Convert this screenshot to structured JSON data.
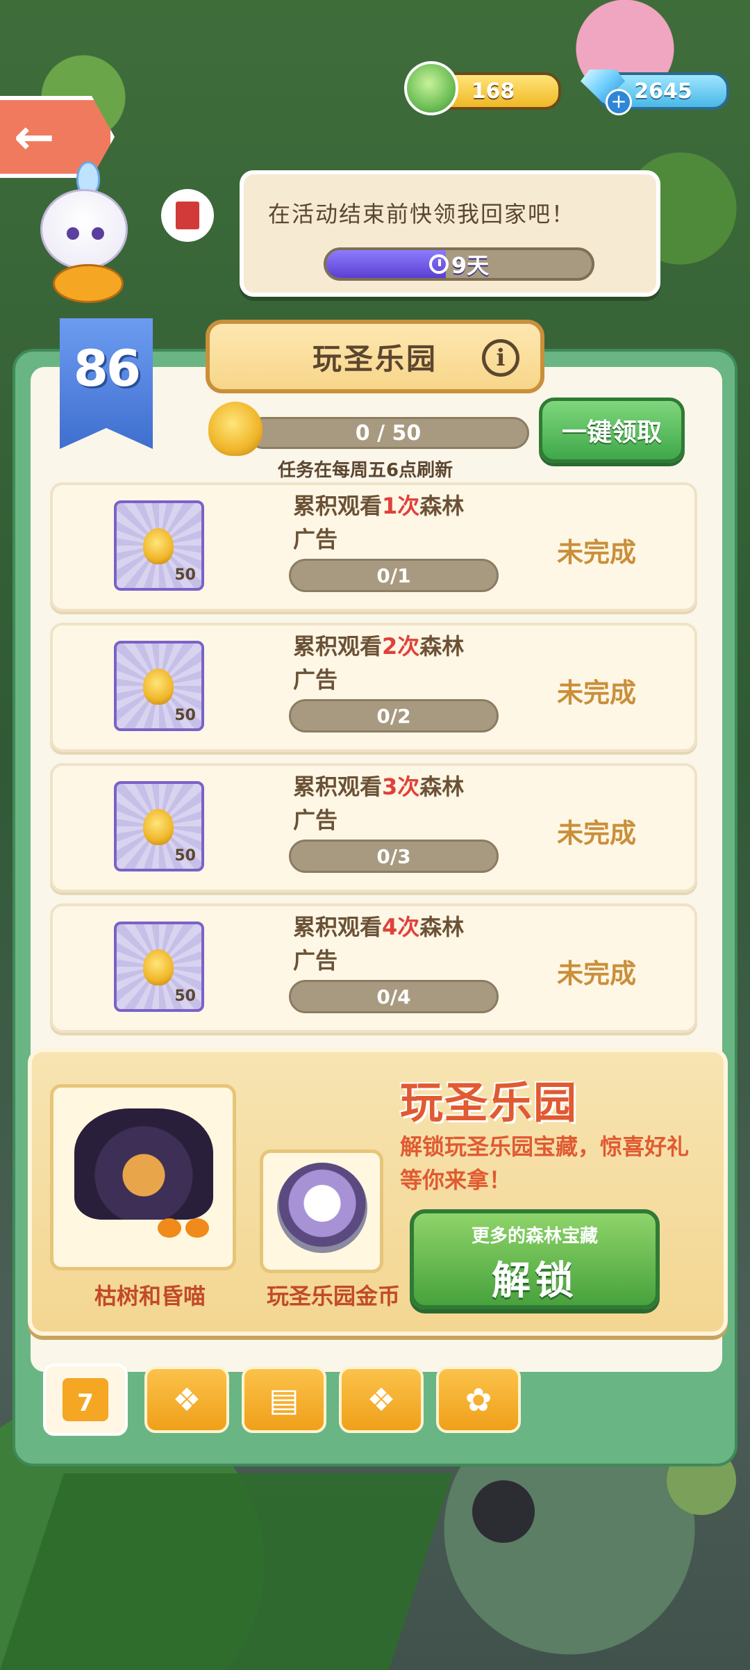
{
  "currency": {
    "leaf_count": "168",
    "gem_count": "2645"
  },
  "speech": {
    "message": "在活动结束前快领我回家吧！",
    "timer_label": "9天",
    "timer_fraction": 0.45
  },
  "level": "86",
  "panel": {
    "title": "玩圣乐园",
    "progress_text": "0 / 50",
    "claim_all_label": "一键领取",
    "refresh_note": "任务在每周五6点刷新"
  },
  "tasks": [
    {
      "pre": "累积观看",
      "count": "1次",
      "post": "森林广告",
      "reward": "50",
      "progress": "0/1",
      "status": "未完成"
    },
    {
      "pre": "累积观看",
      "count": "2次",
      "post": "森林广告",
      "reward": "50",
      "progress": "0/2",
      "status": "未完成"
    },
    {
      "pre": "累积观看",
      "count": "3次",
      "post": "森林广告",
      "reward": "50",
      "progress": "0/3",
      "status": "未完成"
    },
    {
      "pre": "累积观看",
      "count": "4次",
      "post": "森林广告",
      "reward": "50",
      "progress": "0/4",
      "status": "未完成"
    }
  ],
  "unlock": {
    "title": "玩圣乐园",
    "description": "解锁玩圣乐园宝藏，惊喜好礼等你来拿！",
    "item1_caption": "枯树和昏喵",
    "item2_caption": "玩圣乐园金币",
    "button_sub": "更多的森林宝藏",
    "button_main": "解锁"
  },
  "tabs": [
    {
      "name": "calendar",
      "label": "7",
      "active": true
    },
    {
      "name": "megaphone",
      "active": false
    },
    {
      "name": "tickets",
      "active": false
    },
    {
      "name": "gift",
      "active": false
    },
    {
      "name": "leaf",
      "active": false
    }
  ]
}
